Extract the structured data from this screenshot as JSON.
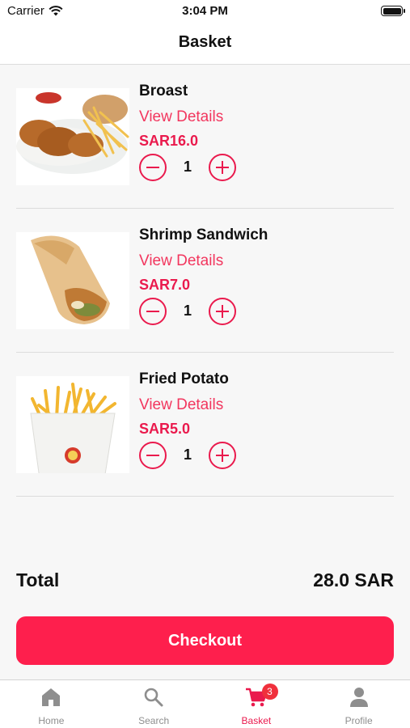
{
  "status_bar": {
    "carrier": "Carrier",
    "time": "3:04 PM",
    "wifi_icon": "wifi-icon",
    "battery_icon": "battery-full-icon"
  },
  "header": {
    "title": "Basket"
  },
  "items": [
    {
      "name": "Broast",
      "details_label": "View Details",
      "price": "SAR16.0",
      "quantity": "1",
      "image": "fried-chicken-plate"
    },
    {
      "name": "Shrimp Sandwich",
      "details_label": "View Details",
      "price": "SAR7.0",
      "quantity": "1",
      "image": "wrap-sandwich"
    },
    {
      "name": "Fried Potato",
      "details_label": "View Details",
      "price": "SAR5.0",
      "quantity": "1",
      "image": "french-fries-box"
    }
  ],
  "summary": {
    "total_label": "Total",
    "total_value": "28.0 SAR"
  },
  "checkout": {
    "label": "Checkout"
  },
  "tab_bar": {
    "tabs": [
      {
        "label": "Home",
        "icon": "home-icon"
      },
      {
        "label": "Search",
        "icon": "search-icon"
      },
      {
        "label": "Basket",
        "icon": "cart-icon",
        "badge": "3"
      },
      {
        "label": "Profile",
        "icon": "person-icon"
      }
    ],
    "active": "Basket"
  },
  "colors": {
    "accent": "#ea1a4d",
    "checkout": "#fe1f4d",
    "background": "#f7f7f7",
    "inactive_tab": "#8e8e8e"
  }
}
